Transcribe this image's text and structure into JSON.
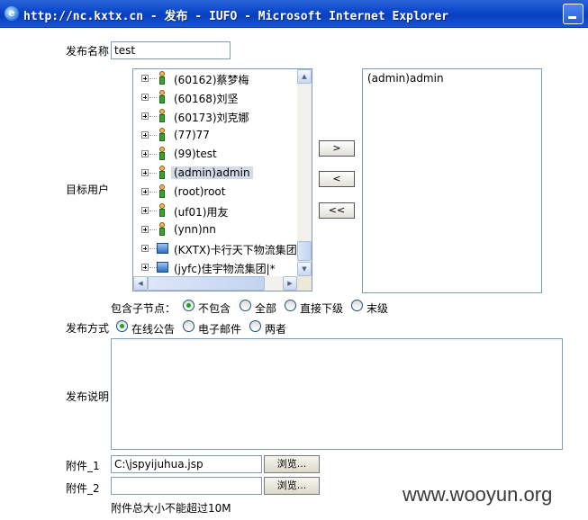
{
  "window": {
    "title": "http://nc.kxtx.cn - 发布 - IUFO - Microsoft Internet Explorer"
  },
  "form": {
    "name_label": "发布名称",
    "name_value": "test",
    "target_label": "目标用户",
    "tree_items": [
      {
        "label": "(60162)蔡梦梅",
        "type": "user",
        "selected": false
      },
      {
        "label": "(60168)刘坚",
        "type": "user",
        "selected": false
      },
      {
        "label": "(60173)刘克娜",
        "type": "user",
        "selected": false
      },
      {
        "label": "(77)77",
        "type": "user",
        "selected": false
      },
      {
        "label": "(99)test",
        "type": "user",
        "selected": false
      },
      {
        "label": "(admin)admin",
        "type": "user",
        "selected": true
      },
      {
        "label": "(root)root",
        "type": "user",
        "selected": false
      },
      {
        "label": "(uf01)用友",
        "type": "user",
        "selected": false
      },
      {
        "label": "(ynn)nn",
        "type": "user",
        "selected": false
      },
      {
        "label": "(KXTX)卡行天下物流集团|",
        "type": "org",
        "selected": false
      },
      {
        "label": "(jyfc)佳宇物流集团|*",
        "type": "org",
        "selected": false
      }
    ],
    "move_buttons": {
      "add": ">",
      "remove": "<",
      "remove_all": "<<"
    },
    "selected_users": [
      "(admin)admin"
    ],
    "include_label": "包含子节点：",
    "include_options": [
      {
        "label": "不包含",
        "checked": true
      },
      {
        "label": "全部",
        "checked": false
      },
      {
        "label": "直接下级",
        "checked": false
      },
      {
        "label": "末级",
        "checked": false
      }
    ],
    "method_label": "发布方式",
    "method_options": [
      {
        "label": "在线公告",
        "checked": true
      },
      {
        "label": "电子邮件",
        "checked": false
      },
      {
        "label": "两者",
        "checked": false
      }
    ],
    "desc_label": "发布说明",
    "attach1_label": "附件_1",
    "attach1_value": "C:\\jspyijuhua.jsp",
    "attach2_label": "附件_2",
    "attach2_value": "",
    "browse_label": "浏览...",
    "size_note": "附件总大小不能超过10M"
  },
  "watermark": "www.wooyun.org"
}
